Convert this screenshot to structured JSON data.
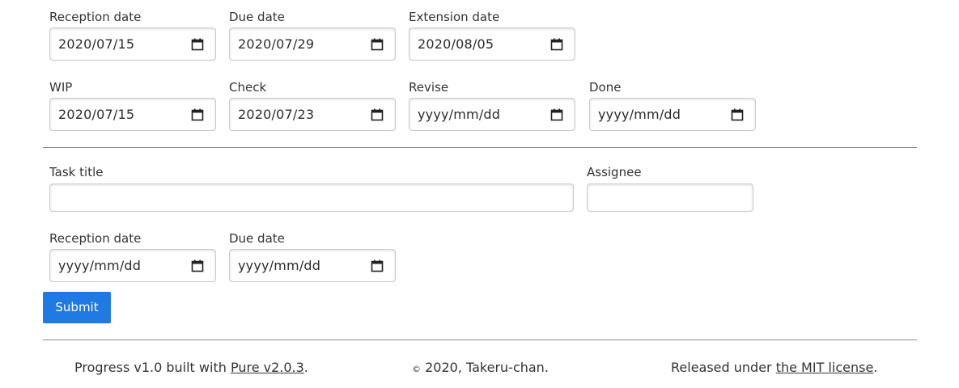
{
  "section1": {
    "row1": [
      {
        "label": "Reception date",
        "value": "2020/07/15"
      },
      {
        "label": "Due date",
        "value": "2020/07/29"
      },
      {
        "label": "Extension date",
        "value": "2020/08/05"
      }
    ],
    "row2": [
      {
        "label": "WIP",
        "value": "2020/07/15"
      },
      {
        "label": "Check",
        "value": "2020/07/23"
      },
      {
        "label": "Revise",
        "value": "yyyy/mm/dd"
      },
      {
        "label": "Done",
        "value": "yyyy/mm/dd"
      }
    ]
  },
  "new_task_form": {
    "task_title_label": "Task title",
    "task_title_value": "",
    "assignee_label": "Assignee",
    "assignee_value": "",
    "dates": [
      {
        "label": "Reception date",
        "value": "yyyy/mm/dd"
      },
      {
        "label": "Due date",
        "value": "yyyy/mm/dd"
      }
    ],
    "submit_label": "Submit"
  },
  "footer": {
    "built_prefix": "Progress v1.0 built with ",
    "pure_link": "Pure v2.0.3",
    "built_suffix": ".",
    "copyright_symbol": "©",
    "copyright_text": " 2020, Takeru-chan.",
    "license_prefix": "Released under ",
    "license_link": "the MIT license",
    "license_suffix": "."
  },
  "colors": {
    "accent": "#1f7ae3",
    "divider": "#8c8c8c",
    "border": "#cccccc"
  },
  "icons": {
    "date_picker": "calendar-icon"
  }
}
